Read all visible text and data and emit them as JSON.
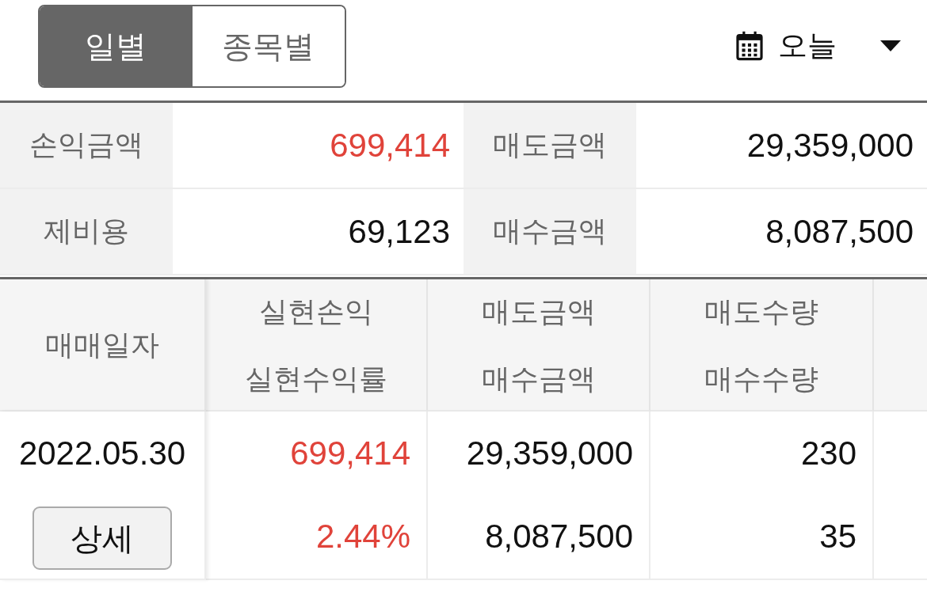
{
  "view_tabs": [
    {
      "label": "일별",
      "selected": true
    },
    {
      "label": "종목별",
      "selected": false
    }
  ],
  "period_dropdown": {
    "label": "오늘"
  },
  "summary": [
    {
      "label": "손익금액",
      "value": "699,414",
      "color": "#e0433a"
    },
    {
      "label": "매도금액",
      "value": "29,359,000",
      "color": "#111111"
    },
    {
      "label": "제비용",
      "value": "69,123",
      "color": "#111111"
    },
    {
      "label": "매수금액",
      "value": "8,087,500",
      "color": "#111111"
    }
  ],
  "table": {
    "columns": [
      {
        "lines": [
          "매매일자"
        ]
      },
      {
        "lines": [
          "실현손익",
          "실현수익률"
        ]
      },
      {
        "lines": [
          "매도금액",
          "매수금액"
        ]
      },
      {
        "lines": [
          "매도수량",
          "매수수량"
        ]
      }
    ],
    "rows": [
      {
        "cells": [
          {
            "kind": "date",
            "lines": [
              "2022.05.30"
            ],
            "button": "상세"
          },
          {
            "kind": "number",
            "lines": [
              "699,414",
              "2.44%"
            ],
            "color": "#e0433a"
          },
          {
            "kind": "number",
            "lines": [
              "29,359,000",
              "8,087,500"
            ],
            "color": "#111111"
          },
          {
            "kind": "number",
            "lines": [
              "230",
              "35"
            ],
            "color": "#111111"
          }
        ]
      }
    ]
  }
}
